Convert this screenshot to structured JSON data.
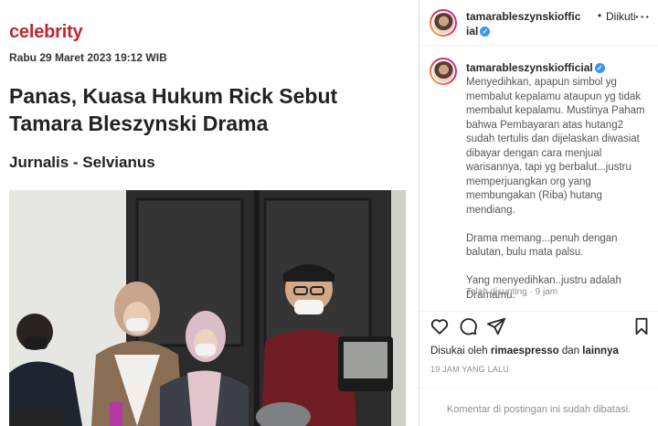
{
  "article": {
    "category": "celebrity",
    "date": "Rabu 29 Maret 2023 19:12 WIB",
    "headline": "Panas, Kuasa Hukum Rick Sebut Tamara Bleszynski Drama",
    "byline": "Jurnalis - Selvianus"
  },
  "post": {
    "header_username": "tamarableszynskiofficial",
    "separator": "•",
    "follow_status": "Diikuti",
    "more_glyph": "···",
    "caption_username": "tamarableszynskiofficial",
    "caption": "Menyedihkan, apapun simbol yg membalut kepalamu ataupun yg tidak membalut kepalamu. Mustinya Paham bahwa Pembayaran atas hutang2 sudah tertulis dan dijelaskan diwasiat dibayar dengan cara menjual warisannya, tapi yg berbalut...justru memperjuangkan org yang membungakan (Riba) hutang mendiang.\n\nDrama memang...penuh dengan balutan, bulu mata palsu.\n\nYang menyedihkan..justru adalah Dramamu.",
    "edited": "Telah disunting · 9 jam",
    "likes_prefix": "Disukai oleh",
    "likes_user": "rimaespresso",
    "likes_and": "dan",
    "likes_others": "lainnya",
    "time": "19 JAM YANG LALU",
    "comments_disabled": "Komentar di postingan ini sudah dibatasi."
  },
  "icons": [
    "heart-icon",
    "comment-icon",
    "share-icon",
    "bookmark-icon",
    "verified-icon",
    "more-icon"
  ],
  "colors": {
    "category": "#c0272d",
    "verified": "#3897f0",
    "muted": "#8e8e8e"
  }
}
